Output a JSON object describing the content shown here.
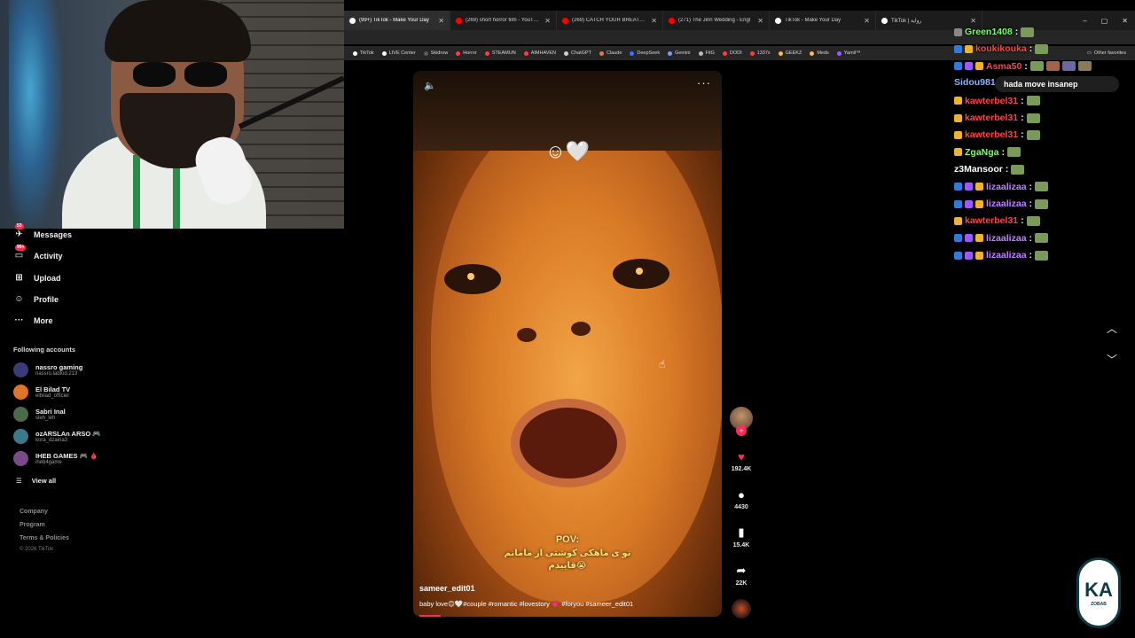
{
  "browser": {
    "tabs": [
      {
        "label": "(99+) TikTok - Make Your Day",
        "color": "#ffffff",
        "active": true
      },
      {
        "label": "(269) short horror film - YouTube",
        "color": "#ff0000",
        "active": false
      },
      {
        "label": "(269) CATCH YOUR BREATH - Awa",
        "color": "#ff0000",
        "active": false
      },
      {
        "label": "(271) The Jinn Wedding - Engl",
        "color": "#ff0000",
        "active": false
      },
      {
        "label": "TikTok - Make Your Day",
        "color": "#ffffff",
        "active": false
      },
      {
        "label": "TikTok | رواية",
        "color": "#ffffff",
        "active": false
      }
    ],
    "window_controls": {
      "minimize": "–",
      "maximize": "▢",
      "close": "✕"
    },
    "bookmarks": [
      {
        "label": "TikTok",
        "color": "#ffffff"
      },
      {
        "label": "LIVE Center",
        "color": "#ffffff"
      },
      {
        "label": "Skidrow",
        "color": "#5a5a5a"
      },
      {
        "label": "Horror",
        "color": "#ff3b3b"
      },
      {
        "label": "STEAMUN",
        "color": "#ff3b3b"
      },
      {
        "label": "AIMHAVEN",
        "color": "#ff3b3b"
      },
      {
        "label": "ChatGPT",
        "color": "#d0d0d0"
      },
      {
        "label": "Claude",
        "color": "#e07a4a"
      },
      {
        "label": "DeepSeek",
        "color": "#4a6cff"
      },
      {
        "label": "Gemini",
        "color": "#7a9cff"
      },
      {
        "label": "FitG",
        "color": "#bbbbbb"
      },
      {
        "label": "DODI",
        "color": "#ff3b3b"
      },
      {
        "label": "1337x",
        "color": "#ff3b3b"
      },
      {
        "label": "GEEKZ",
        "color": "#ffb84a"
      },
      {
        "label": "Meds",
        "color": "#ffb84a"
      },
      {
        "label": "Yamil™",
        "color": "#9b59ff"
      }
    ],
    "other_favorites": "Other favorites"
  },
  "sidebar": {
    "nav": [
      {
        "label": "Messages",
        "icon": "paper-plane-icon",
        "glyph": "✈",
        "badge": "53"
      },
      {
        "label": "Activity",
        "icon": "inbox-icon",
        "glyph": "▭",
        "badge": "99+"
      },
      {
        "label": "Upload",
        "icon": "plus-square-icon",
        "glyph": "⊞",
        "badge": ""
      },
      {
        "label": "Profile",
        "icon": "user-icon",
        "glyph": "☺",
        "badge": ""
      },
      {
        "label": "More",
        "icon": "ellipsis-icon",
        "glyph": "···",
        "badge": ""
      }
    ],
    "following_header": "Following accounts",
    "accounts": [
      {
        "name": "nassro gaming",
        "handle": "nassro.lablod.213",
        "color": "#3b3b7a"
      },
      {
        "name": "El Bilad TV",
        "handle": "elbilad_officiel",
        "color": "#e0742a"
      },
      {
        "name": "Sabri Inal",
        "handle": "sleh_leh",
        "color": "#4a6a4a"
      },
      {
        "name": "ozARSLAn ARSO 🎮",
        "handle": "kora_dzairia3",
        "color": "#3a7a8a"
      },
      {
        "name": "IHEB GAMES 🎮 🩸",
        "handle": "iheb4game",
        "color": "#7a4a8a"
      }
    ],
    "view_all": "View all",
    "footer": [
      "Company",
      "Program",
      "Terms & Policies"
    ],
    "copyright": "© 2026 TikTok"
  },
  "video": {
    "emoji_overlay": "☺🤍",
    "pov": "POV:",
    "subtitle_line1": "تو ی ماهکی کوشتی از مامانم",
    "subtitle_line2": "قاییدم😭",
    "author": "sameer_edit01",
    "caption": "baby love😊🤍#couple #romantic #lovestory 💗 #foryou #sameer_edit01",
    "progress": 0.07
  },
  "actions": {
    "likes": "192.4K",
    "comments": "4430",
    "saves": "15.4K",
    "shares": "22K"
  },
  "chat": {
    "tooltip": "hada move insane",
    "tooltip_suffix": "p",
    "lines": [
      {
        "user": "Green1408",
        "color": "#7cff6a",
        "badges": [
          "none"
        ],
        "emotes": 1
      },
      {
        "user": "koukikouka",
        "color": "#ff4444",
        "badges": [
          "blue",
          "gold"
        ],
        "emotes": 1
      },
      {
        "user": "Asma50",
        "color": "#ff4444",
        "badges": [
          "blue",
          "purple",
          "gold"
        ],
        "emotes": 4
      },
      {
        "user": "Sidou981",
        "color": "#8ab4ff",
        "badges": [],
        "emotes": 0
      },
      {
        "user": "kawterbel31",
        "color": "#ff4444",
        "badges": [
          "gold"
        ],
        "emotes": 1
      },
      {
        "user": "kawterbel31",
        "color": "#ff4444",
        "badges": [
          "gold"
        ],
        "emotes": 1
      },
      {
        "user": "kawterbel31",
        "color": "#ff4444",
        "badges": [
          "gold"
        ],
        "emotes": 1
      },
      {
        "user": "ZgaNga",
        "color": "#7cff6a",
        "badges": [
          "gold"
        ],
        "emotes": 1
      },
      {
        "user": "z3Mansoor",
        "color": "#ffffff",
        "badges": [],
        "emotes": 1
      },
      {
        "user": "lizaalizaa",
        "color": "#c080ff",
        "badges": [
          "blue",
          "purple",
          "gold"
        ],
        "emotes": 1
      },
      {
        "user": "lizaalizaa",
        "color": "#c080ff",
        "badges": [
          "blue",
          "purple",
          "gold"
        ],
        "emotes": 1
      },
      {
        "user": "kawterbel31",
        "color": "#ff4444",
        "badges": [
          "gold"
        ],
        "emotes": 1
      },
      {
        "user": "lizaalizaa",
        "color": "#c080ff",
        "badges": [
          "blue",
          "purple",
          "gold"
        ],
        "emotes": 1
      },
      {
        "user": "lizaalizaa",
        "color": "#c080ff",
        "badges": [
          "blue",
          "purple",
          "gold"
        ],
        "emotes": 1
      }
    ]
  },
  "stream_logo": {
    "mark": "KA",
    "subtitle": "ZOBAB"
  },
  "colors": {
    "tiktok_red": "#fe2c55",
    "badge_blue": "#2f7bd9",
    "badge_purple": "#9b59ff",
    "badge_gold": "#f0b42a"
  }
}
